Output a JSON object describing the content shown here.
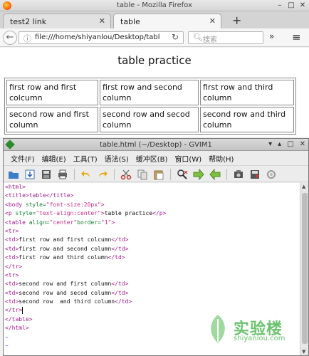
{
  "firefox": {
    "window_title": "table - Mozilla Firefox",
    "tabs": [
      {
        "label": "test2 link",
        "active": false
      },
      {
        "label": "table",
        "active": true
      }
    ],
    "url": "file:///home/shiyanlou/Desktop/tabl",
    "search_placeholder": "搜索",
    "page": {
      "heading": "table practice",
      "table": [
        [
          "first row and first colcumn",
          "first row and second column",
          "first row and third column"
        ],
        [
          "second row and first column",
          "second row and secod column",
          "second row and third column"
        ]
      ]
    }
  },
  "gvim": {
    "window_title": "table.html (~/Desktop) - GVIM1",
    "menu": [
      "文件(F)",
      "编辑(E)",
      "工具(T)",
      "语法(S)",
      "缓冲区(B)",
      "窗口(W)",
      "帮助(H)"
    ],
    "toolbar_icons": [
      "open-icon",
      "save-download-icon",
      "save-icon",
      "print-icon",
      "undo-icon",
      "redo-icon",
      "cut-icon",
      "copy-icon",
      "paste-icon",
      "find-replace-icon",
      "forward-icon",
      "back-icon",
      "load-session-icon",
      "save-session-icon",
      "run-script-icon"
    ],
    "code_lines": [
      "<html>",
      "<title>table</title>",
      "<body style=\"font-size:20px\">",
      "<p style=\"text-align:center\">table practice</p>",
      "<table align=\"center\"border=\"1\">",
      "<tr>",
      "<td>first row and first colcumn</td>",
      "<td>first row and second column</td>",
      "<td>first row and third column</td>",
      "</tr>",
      "<tr>",
      "<td>second row and first column</td>",
      "<td>second row and secod column</td>",
      "<td>second row  and third column</td>",
      "</tr>",
      "</table>",
      "</html>",
      "~",
      "~"
    ]
  },
  "watermark": {
    "text": "实验楼",
    "sub": "shiyanlou.com"
  }
}
